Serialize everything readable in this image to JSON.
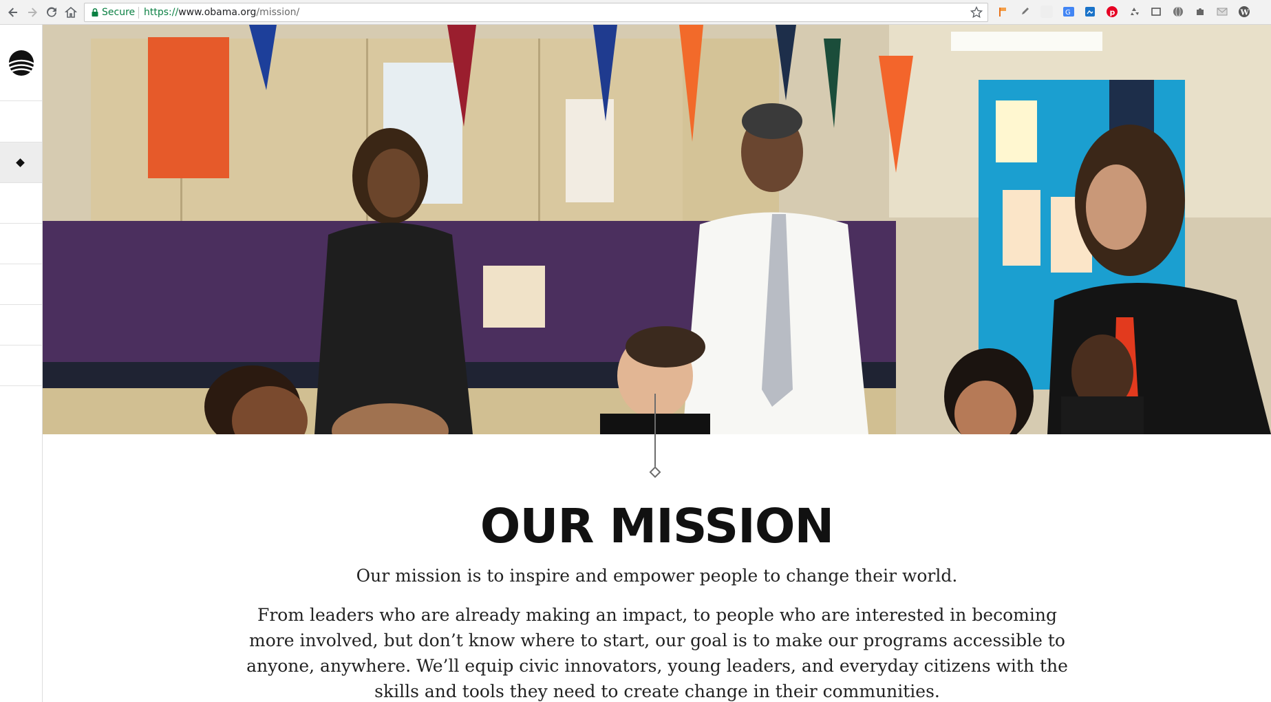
{
  "browser": {
    "secure_label": "Secure",
    "url_scheme": "https://",
    "url_host": "www.obama.org",
    "url_path": "/mission/",
    "icons": {
      "back": "back-icon",
      "forward": "forward-icon",
      "reload": "reload-icon",
      "home": "home-icon",
      "lock": "lock-icon",
      "bookmark": "star-icon"
    },
    "extensions": [
      "flag-icon",
      "eyedropper-icon",
      "translate-icon",
      "screenshot-icon",
      "pinterest-icon",
      "recycle-icon",
      "crop-icon",
      "globe-icon",
      "puzzle-icon",
      "gmail-icon",
      "wordpress-icon"
    ],
    "colors": {
      "secure": "#0b8043",
      "toolbar": "#f2f2f2"
    }
  },
  "sidebar": {
    "logo": "obama-foundation-logo",
    "slots": [
      "slot-1",
      "slot-2",
      "slot-3",
      "slot-4",
      "slot-5",
      "slot-6",
      "slot-7"
    ],
    "active_index": 1
  },
  "hero": {
    "image": "classroom-photo"
  },
  "content": {
    "title": "OUR MISSION",
    "lead": "Our mission is to inspire and empower people to change their world.",
    "body": "From leaders who are already making an impact, to people who are interested in becoming more involved, but don’t know where to start, our goal is to make our programs accessible to anyone, anywhere. We’ll equip civic innovators, young leaders, and everyday citizens with the skills and tools they need to create change in their communities."
  }
}
